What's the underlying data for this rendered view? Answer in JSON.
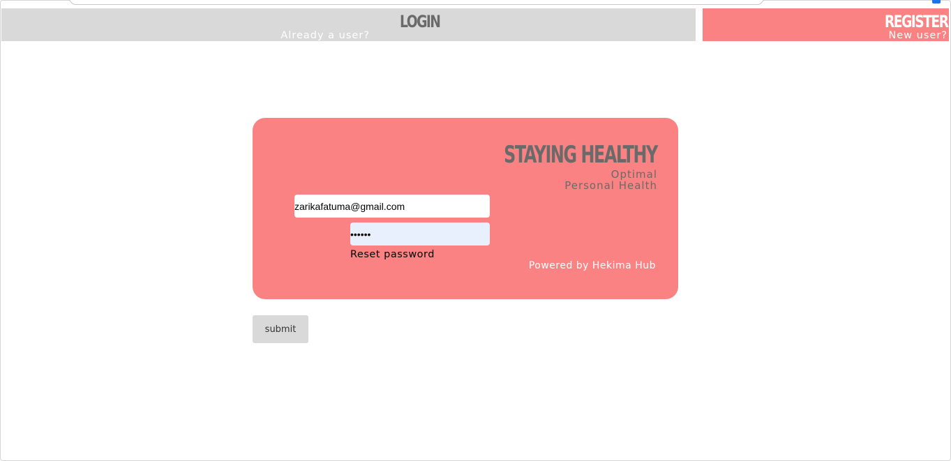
{
  "nav": {
    "login": {
      "title": "LOGIN",
      "subtitle": "Already a user?"
    },
    "register": {
      "title": "REGISTER",
      "subtitle": "New user?"
    }
  },
  "brand": {
    "title": "STAYING HEALTHY",
    "line1": "Optimal",
    "line2": "Personal Health"
  },
  "form": {
    "email_value": "zarikafatuma@gmail.com",
    "password_value": "••••••",
    "reset_label": "Reset password",
    "powered_by": "Powered by Hekima Hub",
    "submit_label": "submit"
  },
  "colors": {
    "accent": "#fa8282",
    "tab_inactive": "#d9d9d9",
    "brand_text": "#6a6a6a",
    "password_autofill_bg": "#e8f0fe"
  }
}
